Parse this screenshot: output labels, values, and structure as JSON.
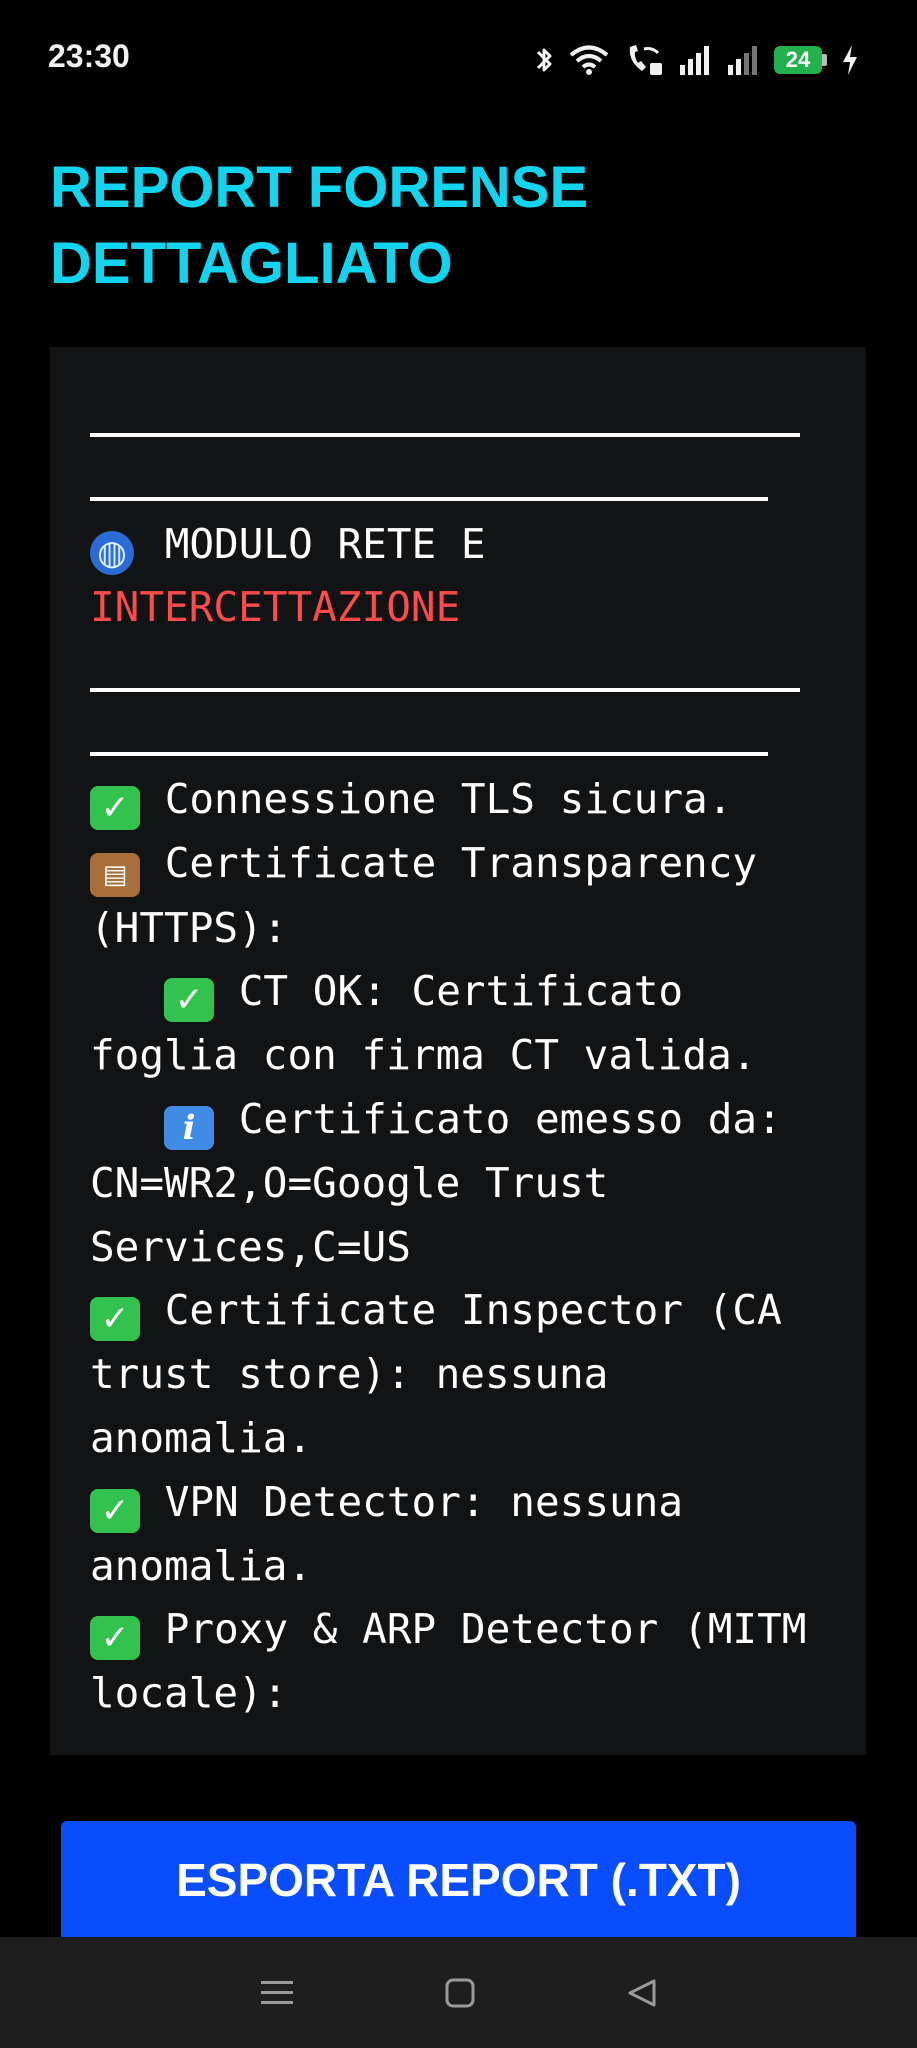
{
  "status_bar": {
    "time": "23:30",
    "battery_level": "24",
    "icons": [
      "bluetooth-icon",
      "wifi-icon",
      "wifi-calling-icon",
      "signal-icon",
      "signal-weak-icon",
      "battery-icon",
      "charging-icon"
    ],
    "battery_color": "#22b14c"
  },
  "header": {
    "title": "REPORT FORENSE DETTAGLIATO",
    "title_color": "#13d4ee"
  },
  "report": {
    "section_prefix": "MODULO RETE E",
    "section_highlight": "INTERCETTAZIONE",
    "highlight_color": "#ff4b4b",
    "lines": [
      {
        "icon": "check-mark-icon",
        "indent": false,
        "text": "Connessione TLS sicura."
      },
      {
        "icon": "clipboard-icon",
        "indent": false,
        "text": "Certificate Transparency (HTTPS):"
      },
      {
        "icon": "check-mark-icon",
        "indent": true,
        "text": "CT OK: Certificato foglia con firma CT valida."
      },
      {
        "icon": "info-icon",
        "indent": true,
        "text": "Certificato emesso da: CN=WR2,O=Google Trust Services,C=US"
      },
      {
        "icon": "check-mark-icon",
        "indent": false,
        "text": "Certificate Inspector (CA trust store): nessuna anomalia."
      },
      {
        "icon": "check-mark-icon",
        "indent": false,
        "text": "VPN Detector: nessuna anomalia."
      },
      {
        "icon": "check-mark-icon",
        "indent": false,
        "text": "Proxy & ARP Detector (MITM locale):"
      }
    ]
  },
  "actions": {
    "export_label": "ESPORTA REPORT (.TXT)",
    "export_color": "#0a4dff"
  },
  "nav_bar": {
    "icons": [
      "menu-icon",
      "home-square-icon",
      "back-triangle-icon"
    ]
  }
}
